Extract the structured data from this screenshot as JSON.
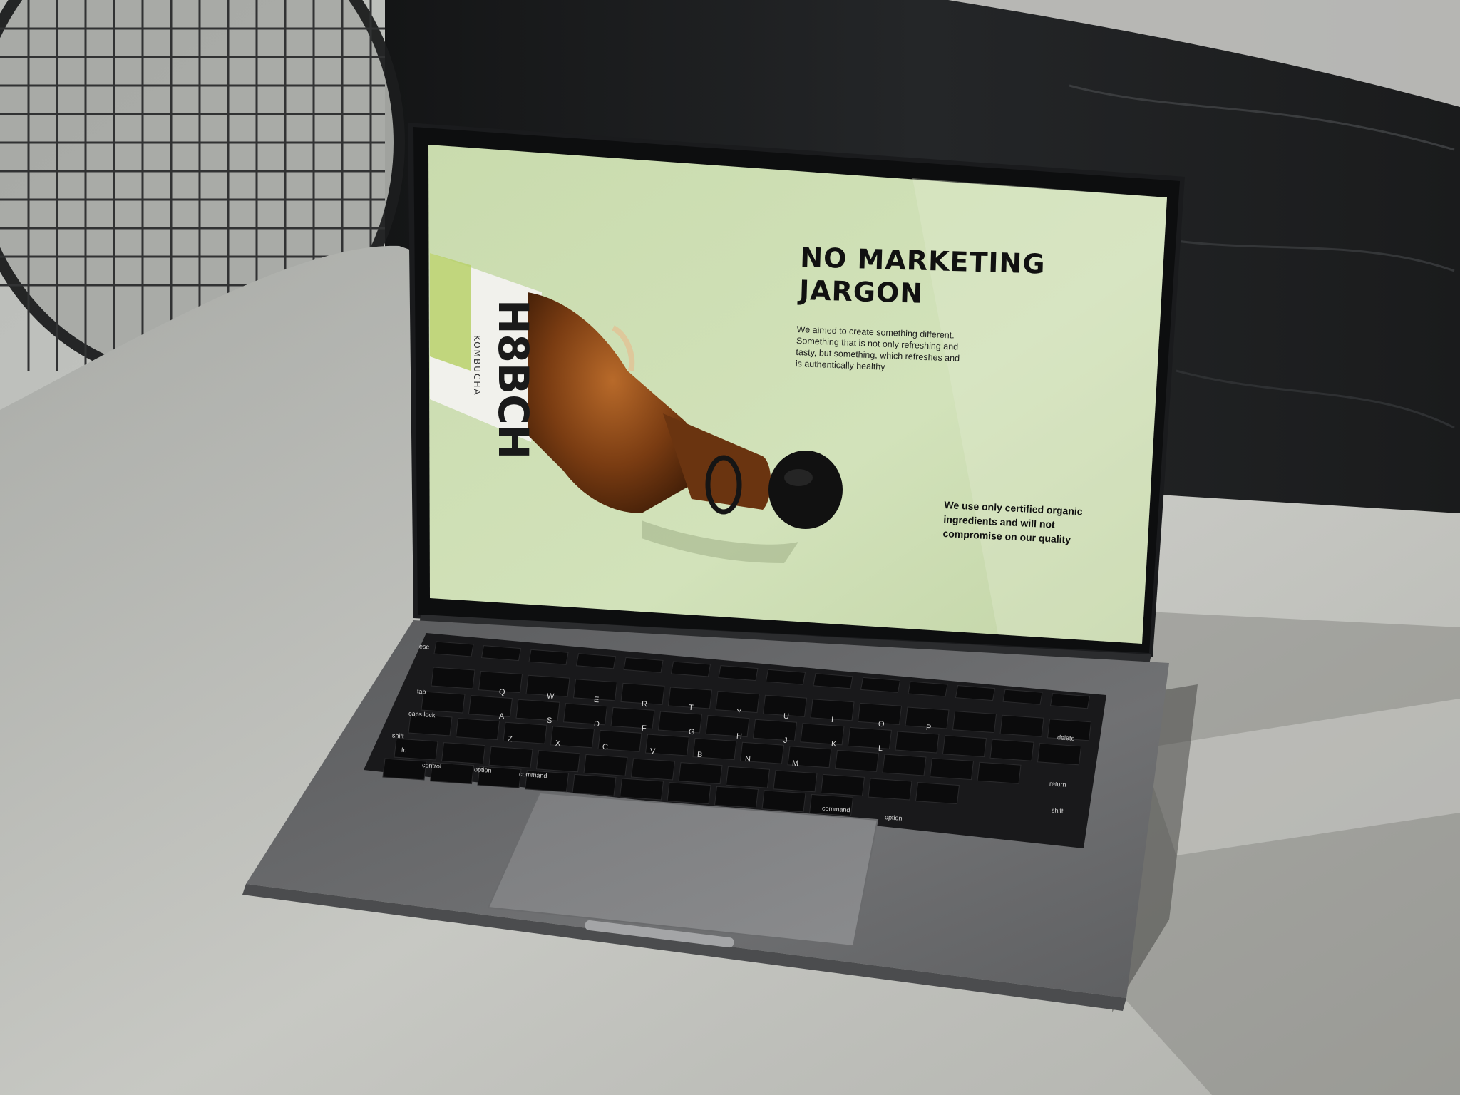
{
  "screen": {
    "headline_line1": "NO MARKETING",
    "headline_line2": "JARGON",
    "body_copy": "We aimed to create something different. Something that is not only refreshing and tasty, but something, which refreshes and is authentically healthy",
    "promise": "We use only certified organic ingredients and will not compromise on our quality",
    "bottle_brand": "H8BCH",
    "bottle_sub": "KOMBUCHA",
    "background_color": "#cbdcb1"
  },
  "keyboard": {
    "esc": "esc",
    "tab": "tab",
    "caps_lock": "caps lock",
    "shift_left": "shift",
    "fn": "fn",
    "control": "control",
    "option_left": "option",
    "command_left": "command",
    "command_symbol": "⌘",
    "option_symbol": "⌥",
    "delete": "delete",
    "return": "return",
    "shift_right": "shift",
    "command_right": "command",
    "option_right": "option",
    "row_q": [
      "Q",
      "W",
      "E",
      "R",
      "T",
      "Y",
      "U",
      "I",
      "O",
      "P"
    ],
    "row_a": [
      "A",
      "S",
      "D",
      "F",
      "G",
      "H",
      "J",
      "K",
      "L"
    ],
    "row_z": [
      "Z",
      "X",
      "C",
      "V",
      "B",
      "N",
      "M"
    ]
  }
}
